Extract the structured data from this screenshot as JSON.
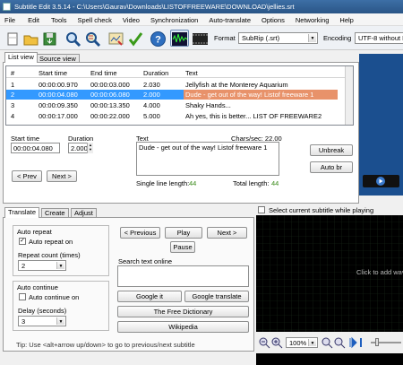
{
  "window": {
    "title": "Subtitle Edit 3.5.14 - C:\\Users\\Gaurav\\Downloads\\LISTOFFREEWARE\\DOWNLOAD\\jellies.srt"
  },
  "menu": [
    "File",
    "Edit",
    "Tools",
    "Spell check",
    "Video",
    "Synchronization",
    "Auto-translate",
    "Options",
    "Networking",
    "Help"
  ],
  "toolbar": {
    "format_label": "Format",
    "format_value": "SubRip (.srt)",
    "encoding_label": "Encoding",
    "encoding_value": "UTF-8 without BOM"
  },
  "tabs": {
    "list_view": "List view",
    "source_view": "Source view"
  },
  "table": {
    "headers": [
      "#",
      "Start time",
      "End time",
      "Duration",
      "Text"
    ],
    "rows": [
      {
        "num": "1",
        "start": "00:00:00.970",
        "end": "00:00:03.000",
        "dur": "2.030",
        "text": "Jellyfish at the Monterey Aquarium"
      },
      {
        "num": "2",
        "start": "00:00:04.080",
        "end": "00:00:06.080",
        "dur": "2.000",
        "text": "Dude - get out of the way! Listof freeware 1"
      },
      {
        "num": "3",
        "start": "00:00:09.350",
        "end": "00:00:13.350",
        "dur": "4.000",
        "text": "Shaky Hands..."
      },
      {
        "num": "4",
        "start": "00:00:17.000",
        "end": "00:00:22.000",
        "dur": "5.000",
        "text": "Ah yes, this is better... LIST OF FREEWARE2"
      }
    ]
  },
  "editor": {
    "start_label": "Start time",
    "start_value": "00:00:04.080",
    "duration_label": "Duration",
    "duration_value": "2.000",
    "text_label": "Text",
    "chars_label": "Chars/sec: 22.00",
    "text_value": "Dude - get out of the way! Listof freeware 1",
    "single_line_label": "Single line length:",
    "single_line_value": "44",
    "total_length_label": "Total length:",
    "total_length_value": "44",
    "prev": "< Prev",
    "next": "Next >",
    "unbreak": "Unbreak",
    "auto_br": "Auto br"
  },
  "bottom_tabs": {
    "translate": "Translate",
    "create": "Create",
    "adjust": "Adjust"
  },
  "translate": {
    "auto_repeat_group": "Auto repeat",
    "auto_repeat_on": "Auto repeat on",
    "repeat_count_label": "Repeat count (times)",
    "repeat_count_value": "2",
    "auto_continue_group": "Auto continue",
    "auto_continue_on": "Auto continue on",
    "delay_label": "Delay (seconds)",
    "delay_value": "3",
    "previous": "< Previous",
    "play": "Play",
    "next": "Next >",
    "pause": "Pause",
    "search_label": "Search text online",
    "google_it": "Google it",
    "google_translate": "Google translate",
    "free_dictionary": "The Free Dictionary",
    "wikipedia": "Wikipedia",
    "tip": "Tip: Use <alt+arrow up/down> to go to previous/next subtitle"
  },
  "video": {
    "select_current": "Select current subtitle while playing",
    "click_add": "Click to add wave",
    "zoom": "100%"
  }
}
